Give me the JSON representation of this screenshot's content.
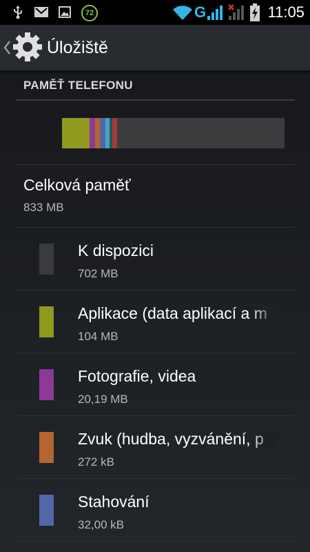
{
  "status_bar": {
    "time": "11:05",
    "network_type": "G",
    "notification_badge": "72",
    "icons": [
      "usb-icon",
      "gmail-icon",
      "image-icon",
      "badge-72-icon",
      "wifi-icon",
      "signal-icon",
      "signal-no-icon",
      "battery-charging-icon"
    ]
  },
  "action_bar": {
    "title": "Úložiště",
    "icons": [
      "chevron-left-icon",
      "gear-icon"
    ]
  },
  "section": {
    "header": "PAMĚŤ TELEFONU"
  },
  "usage_bar": {
    "segments": [
      {
        "name": "Aplikace",
        "color": "#8f9a1f",
        "fraction": 0.124
      },
      {
        "name": "Fotografie",
        "color": "#8b3a98",
        "fraction": 0.026
      },
      {
        "name": "Zvuk",
        "color": "#b5652f",
        "fraction": 0.02
      },
      {
        "name": "Stahování",
        "color": "#5167a8",
        "fraction": 0.025
      },
      {
        "name": "Other1",
        "color": "#4aa3b8",
        "fraction": 0.02
      },
      {
        "name": "Other2",
        "color": "#1f5a63",
        "fraction": 0.012
      },
      {
        "name": "Other3",
        "color": "#a53a36",
        "fraction": 0.02
      },
      {
        "name": "K dispozici",
        "color": "#3b3d3f",
        "fraction": 0.753
      }
    ]
  },
  "total": {
    "label": "Celková paměť",
    "value": "833 MB"
  },
  "rows": [
    {
      "label": "K dispozici",
      "value": "702 MB",
      "color": "#3a3b3d"
    },
    {
      "label": "Aplikace (data aplikací a m",
      "value": "104 MB",
      "color": "#8f9a1f"
    },
    {
      "label": "Fotografie, videa",
      "value": "20,19 MB",
      "color": "#8b3a98"
    },
    {
      "label": "Zvuk (hudba, vyzvánění, p",
      "value": "272 kB",
      "color": "#b5652f"
    },
    {
      "label": "Stahování",
      "value": "32,00 kB",
      "color": "#5167a8"
    }
  ]
}
